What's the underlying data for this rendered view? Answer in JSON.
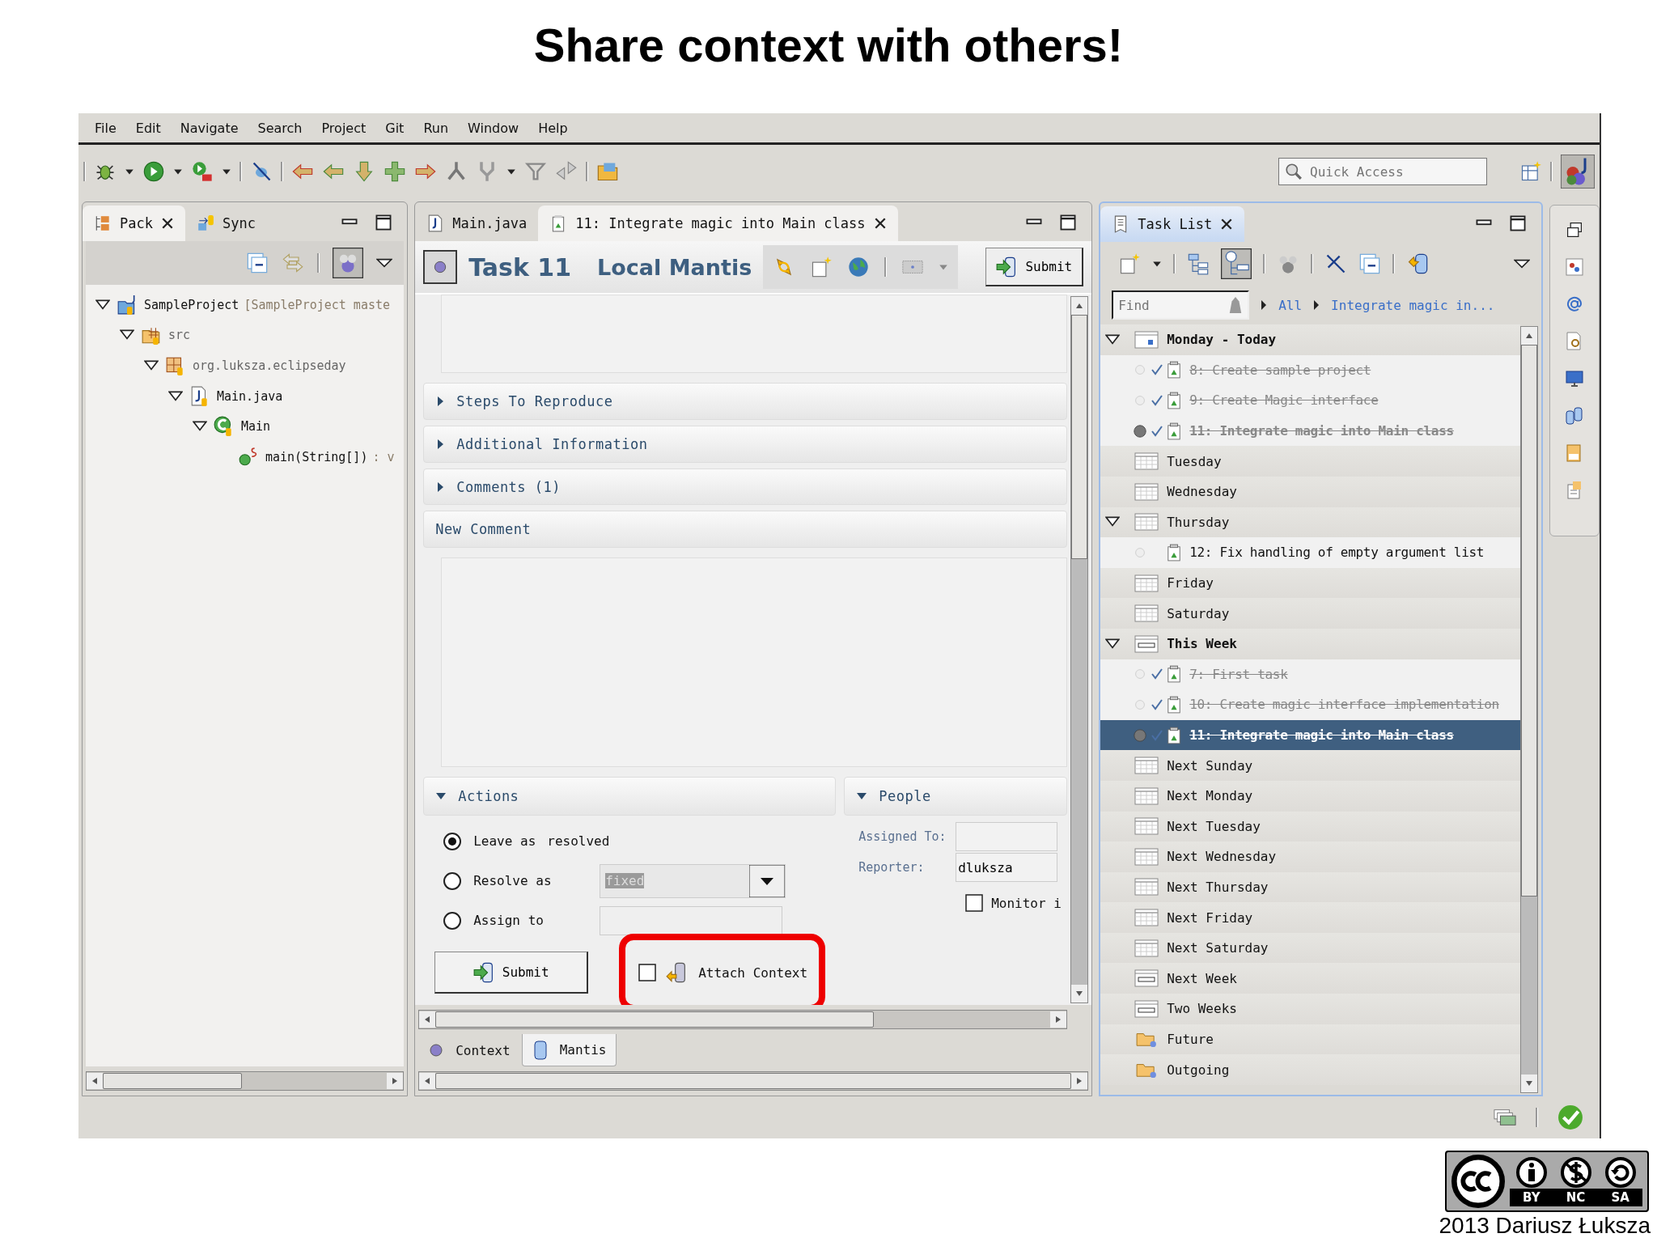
{
  "slide_title": "Share context with others!",
  "menu": [
    "File",
    "Edit",
    "Navigate",
    "Search",
    "Project",
    "Git",
    "Run",
    "Window",
    "Help"
  ],
  "quick_access": {
    "placeholder": "Quick Access"
  },
  "left_panel": {
    "tabs": [
      {
        "label": "Pack",
        "selected": true
      },
      {
        "label": "Sync",
        "selected": false
      }
    ],
    "tree": [
      {
        "label": "SampleProject",
        "decoration": "[SampleProject maste",
        "kind": "project",
        "expanded": true,
        "children": [
          {
            "label": "src",
            "kind": "source",
            "expanded": true,
            "children": [
              {
                "label": "org.luksza.eclipseday",
                "kind": "package",
                "expanded": true,
                "children": [
                  {
                    "label": "Main.java",
                    "kind": "file",
                    "expanded": true,
                    "children": [
                      {
                        "label": "Main",
                        "kind": "class",
                        "expanded": true,
                        "children": [
                          {
                            "label": "main(String[])",
                            "decoration": ": v",
                            "kind": "method"
                          }
                        ]
                      }
                    ]
                  }
                ]
              }
            ]
          }
        ]
      }
    ]
  },
  "editor": {
    "tabs": [
      {
        "label": "Main.java",
        "kind": "java",
        "selected": false
      },
      {
        "label": "11: Integrate magic into Main class",
        "kind": "task",
        "selected": true
      }
    ],
    "task_title": "Task 11",
    "repository": "Local Mantis",
    "submit": "Submit",
    "sections": [
      {
        "label": "Steps To Reproduce",
        "expanded": false
      },
      {
        "label": "Additional Information",
        "expanded": false
      },
      {
        "label": "Comments (1)",
        "expanded": false
      }
    ],
    "new_comment": "New Comment",
    "actions": {
      "title": "Actions",
      "expanded": true,
      "options": [
        {
          "label": "Leave as",
          "value": "resolved",
          "kind": "text",
          "selected": true
        },
        {
          "label": "Resolve as",
          "value": "fixed",
          "kind": "dropdown",
          "selected": false
        },
        {
          "label": "Assign to",
          "kind": "field",
          "selected": false
        }
      ],
      "submit": "Submit",
      "attach_context": {
        "label": "Attach Context",
        "checked": false
      }
    },
    "people": {
      "title": "People",
      "expanded": true,
      "assigned_to_label": "Assigned To:",
      "reporter_label": "Reporter:",
      "reporter": "dluksza",
      "monitor": {
        "label": "Monitor i",
        "checked": false
      }
    },
    "bottom_tabs": [
      {
        "label": "Context",
        "kind": "context",
        "selected": false
      },
      {
        "label": "Mantis",
        "kind": "repository",
        "selected": true
      }
    ]
  },
  "task_list": {
    "title": "Task List",
    "find": {
      "placeholder": "Find"
    },
    "breadcrumb": [
      "All",
      "Integrate magic in..."
    ],
    "groups": [
      {
        "label": "Monday - Today",
        "kind": "today",
        "bold": true,
        "expanded": true,
        "tasks": [
          {
            "label": "8: Create sample project",
            "completed": true,
            "active": false,
            "selected": false
          },
          {
            "label": "9: Create Magic interface",
            "completed": true,
            "active": false,
            "selected": false
          },
          {
            "label": "11: Integrate magic into Main class",
            "completed": true,
            "active": true,
            "selected": false
          }
        ]
      },
      {
        "label": "Tuesday",
        "kind": "day",
        "bold": false
      },
      {
        "label": "Wednesday",
        "kind": "day",
        "bold": false
      },
      {
        "label": "Thursday",
        "kind": "day",
        "bold": false,
        "expanded": true,
        "tasks": [
          {
            "label": "12: Fix handling of empty argument list",
            "completed": false,
            "active": false,
            "selected": false
          }
        ]
      },
      {
        "label": "Friday",
        "kind": "day",
        "bold": false
      },
      {
        "label": "Saturday",
        "kind": "day",
        "bold": false
      },
      {
        "label": "This Week",
        "kind": "week",
        "bold": true,
        "expanded": true,
        "tasks": [
          {
            "label": "7: First task",
            "completed": true,
            "active": false,
            "selected": false
          },
          {
            "label": "10: Create magic interface implementation",
            "completed": true,
            "active": false,
            "selected": false
          },
          {
            "label": "11: Integrate magic into Main class",
            "completed": true,
            "active": true,
            "selected": true
          }
        ]
      },
      {
        "label": "Next Sunday",
        "kind": "day",
        "bold": false
      },
      {
        "label": "Next Monday",
        "kind": "day",
        "bold": false
      },
      {
        "label": "Next Tuesday",
        "kind": "day",
        "bold": false
      },
      {
        "label": "Next Wednesday",
        "kind": "day",
        "bold": false
      },
      {
        "label": "Next Thursday",
        "kind": "day",
        "bold": false
      },
      {
        "label": "Next Friday",
        "kind": "day",
        "bold": false
      },
      {
        "label": "Next Saturday",
        "kind": "day",
        "bold": false
      },
      {
        "label": "Next Week",
        "kind": "week",
        "bold": false
      },
      {
        "label": "Two Weeks",
        "kind": "week",
        "bold": false
      },
      {
        "label": "Future",
        "kind": "folder",
        "bold": false
      },
      {
        "label": "Outgoing",
        "kind": "folder",
        "bold": false
      }
    ]
  },
  "license": [
    "BY",
    "NC",
    "SA"
  ],
  "author": "2013 Dariusz Łuksza"
}
